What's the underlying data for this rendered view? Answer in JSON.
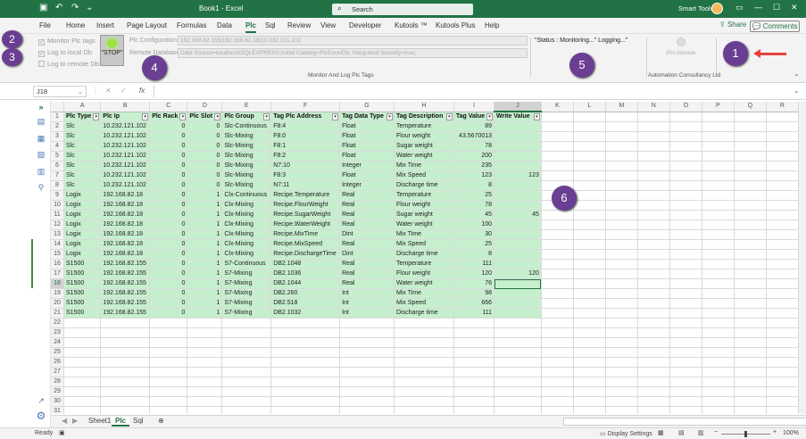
{
  "titlebar": {
    "title": "Book1  -  Excel",
    "search_placeholder": "Search",
    "user": "Smart Tools"
  },
  "menus": [
    "File",
    "Home",
    "Insert",
    "Page Layout",
    "Formulas",
    "Data",
    "Plc",
    "Sql",
    "Review",
    "View",
    "Developer",
    "Kutools ™",
    "Kutools Plus",
    "Help"
  ],
  "active_menu": "Plc",
  "share": "Share",
  "comments": "Comments",
  "ribbon": {
    "checkboxes": [
      "Monitor Plc tags",
      "Log to local Db",
      "Log to remote Db"
    ],
    "stop_label": "\"STOP\"",
    "plc_config_label": "Plc Configuration",
    "plc_config_value": "192.168.82.155|192.168.82.18|10.232.121.102",
    "remote_db_label": "Remote Database",
    "remote_db_value": "Data Source=localhost\\SQLEXPRESS;Initial Catalog=PlcExcelDb; Integrated Security=true;",
    "status": "\"Status : Monitoring...\" Logging...\"",
    "group_label": "Monitor And Log Plc Tags",
    "pro_license": "Pro license",
    "company": "Automation Consultancy Ltd"
  },
  "formulabar": {
    "namebox": "J18",
    "fx": "fx"
  },
  "columns": [
    "A",
    "B",
    "C",
    "D",
    "E",
    "F",
    "G",
    "H",
    "I",
    "J",
    "K",
    "L",
    "M",
    "N",
    "O",
    "P",
    "Q",
    "R"
  ],
  "selected_col": "J",
  "selected_row": 18,
  "headers": [
    "Plc Type",
    "Plc Ip",
    "Plc Rack",
    "Plc Slot",
    "Plc Group",
    "Tag Plc Address",
    "Tag Data Type",
    "Tag Description",
    "Tag Value",
    "Write Value"
  ],
  "rows": [
    [
      "Slc",
      "10.232.121.102",
      "0",
      "0",
      "Slc-Continuous",
      "F8:4",
      "Float",
      "Temperature",
      "89",
      ""
    ],
    [
      "Slc",
      "10.232.121.102",
      "0",
      "0",
      "Slc-Mixing",
      "F8:0",
      "Float",
      "Flour weight",
      "43.5670013",
      ""
    ],
    [
      "Slc",
      "10.232.121.102",
      "0",
      "0",
      "Slc-Mixing",
      "F8:1",
      "Float",
      "Sugar weight",
      "78",
      ""
    ],
    [
      "Slc",
      "10.232.121.102",
      "0",
      "0",
      "Slc-Mixing",
      "F8:2",
      "Float",
      "Water weight",
      "200",
      ""
    ],
    [
      "Slc",
      "10.232.121.102",
      "0",
      "0",
      "Slc-Mixing",
      "N7:10",
      "Integer",
      "Mix Time",
      "235",
      ""
    ],
    [
      "Slc",
      "10.232.121.102",
      "0",
      "0",
      "Slc-Mixing",
      "F8:3",
      "Float",
      "Mix Speed",
      "123",
      "123"
    ],
    [
      "Slc",
      "10.232.121.102",
      "0",
      "0",
      "Slc-Mixing",
      "N7:11",
      "Integer",
      "Discharge time",
      "8",
      ""
    ],
    [
      "Logix",
      "192.168.82.18",
      "0",
      "1",
      "Clx-Continuous",
      "Recipe.Temperature",
      "Real",
      "Temperature",
      "25",
      ""
    ],
    [
      "Logix",
      "192.168.82.18",
      "0",
      "1",
      "Clx-Mixing",
      "Recipe.FlourWeight",
      "Real",
      "Flour weight",
      "78",
      ""
    ],
    [
      "Logix",
      "192.168.82.18",
      "0",
      "1",
      "Clx-Mixing",
      "Recipe.SugarWeight",
      "Real",
      "Sugar weight",
      "45",
      "45"
    ],
    [
      "Logix",
      "192.168.82.18",
      "0",
      "1",
      "Clx-Mixing",
      "Recipe.WaterWeight",
      "Real",
      "Water weight",
      "100",
      ""
    ],
    [
      "Logix",
      "192.168.82.18",
      "0",
      "1",
      "Clx-Mixing",
      "Recipe.MixTime",
      "Dint",
      "Mix Time",
      "30",
      ""
    ],
    [
      "Logix",
      "192.168.82.18",
      "0",
      "1",
      "Clx-Mixing",
      "Recipe.MixSpeed",
      "Real",
      "Mix Speed",
      "25",
      ""
    ],
    [
      "Logix",
      "192.168.82.18",
      "0",
      "1",
      "Clx-Mixing",
      "Recipe.DischargeTime",
      "Dint",
      "Discharge time",
      "8",
      ""
    ],
    [
      "S1500",
      "192.168.82.155",
      "0",
      "1",
      "S7-Continuous",
      "DB2.1048",
      "Real",
      "Temperature",
      "111",
      ""
    ],
    [
      "S1500",
      "192.168.82.155",
      "0",
      "1",
      "S7-Mixing",
      "DB2.1036",
      "Real",
      "Flour weight",
      "120",
      "120"
    ],
    [
      "S1500",
      "192.168.82.155",
      "0",
      "1",
      "S7-Mixing",
      "DB2.1044",
      "Real",
      "Water weight",
      "76",
      ""
    ],
    [
      "S1500",
      "192.168.82.155",
      "0",
      "1",
      "S7-Mixing",
      "DB2.260",
      "Int",
      "Mix Time",
      "98",
      ""
    ],
    [
      "S1500",
      "192.168.82.155",
      "0",
      "1",
      "S7-Mixing",
      "DB2.518",
      "Int",
      "Mix Speed",
      "666",
      ""
    ],
    [
      "S1500",
      "192.168.82.155",
      "0",
      "1",
      "S7-Mixing",
      "DB2.1032",
      "Int",
      "Discharge time",
      "111",
      ""
    ]
  ],
  "total_rows": 33,
  "sheets": [
    "Sheet1",
    "Plc",
    "Sql"
  ],
  "active_sheet": "Plc",
  "status": {
    "ready": "Ready",
    "display_settings": "Display Settings",
    "zoom": "100%"
  },
  "callouts": [
    "1",
    "2",
    "3",
    "4",
    "5",
    "6"
  ],
  "colors": {
    "excel_green": "#217346",
    "table_fill": "#c6efce",
    "callout": "#6a3e93",
    "arrow": "#e8413e"
  }
}
